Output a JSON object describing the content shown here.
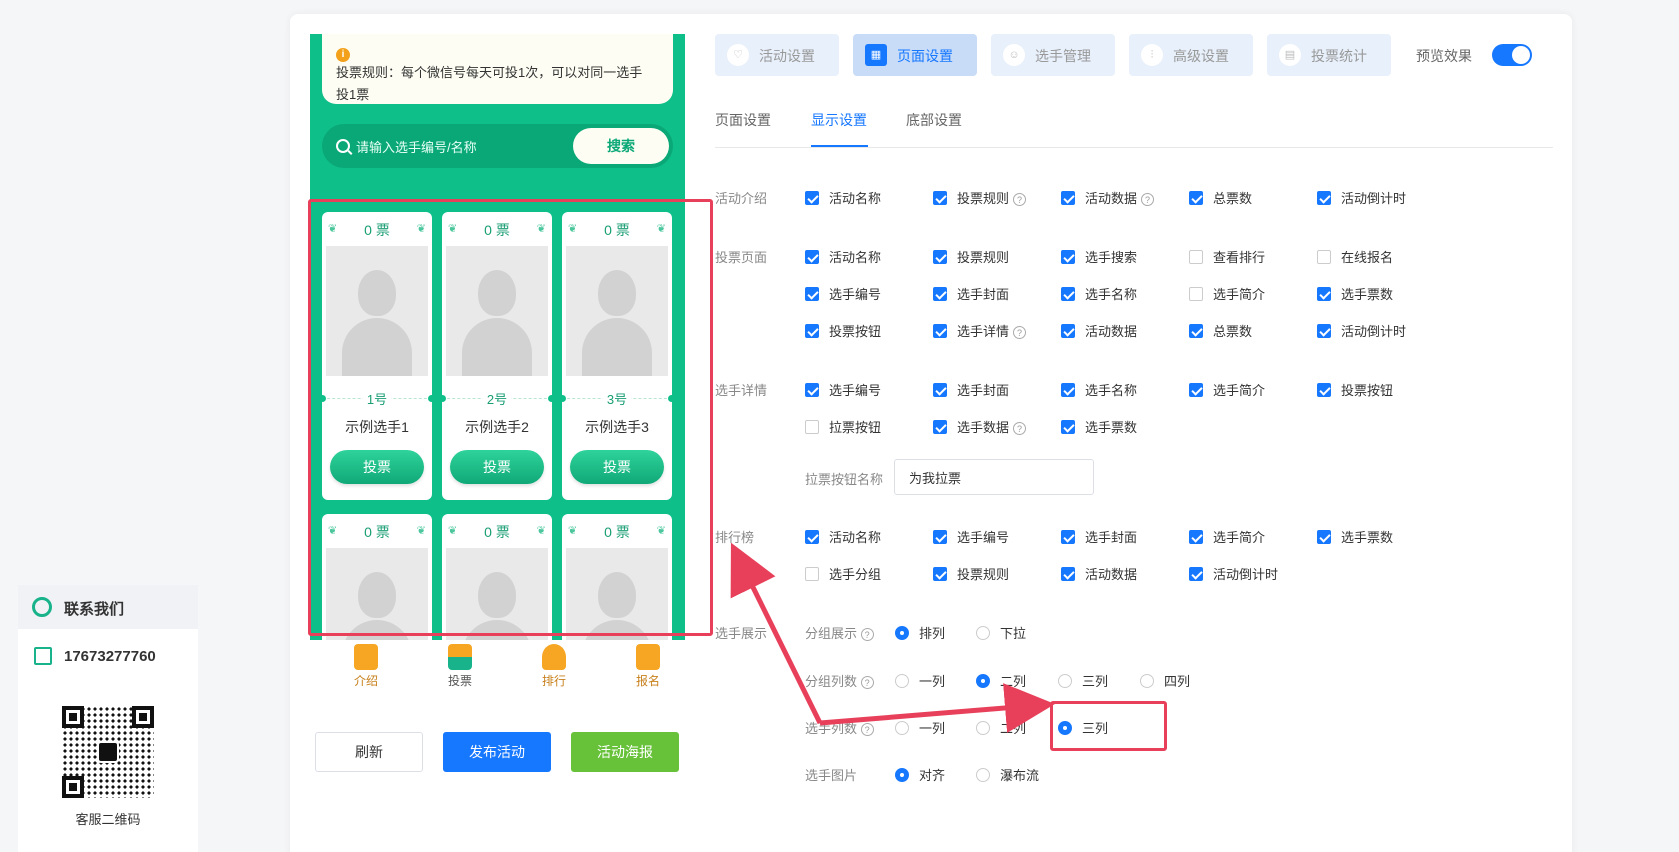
{
  "preview": {
    "rule_text": "投票规则：每个微信号每天可投1次，可以对同一选手投1票",
    "search_placeholder": "请输入选手编号/名称",
    "search_button": "搜索",
    "players": [
      {
        "votes": "0 票",
        "number": "1号",
        "name": "示例选手1",
        "vote_button": "投票"
      },
      {
        "votes": "0 票",
        "number": "2号",
        "name": "示例选手2",
        "vote_button": "投票"
      },
      {
        "votes": "0 票",
        "number": "3号",
        "name": "示例选手3",
        "vote_button": "投票"
      },
      {
        "votes": "0 票"
      },
      {
        "votes": "0 票"
      },
      {
        "votes": "0 票"
      }
    ],
    "nav": [
      {
        "label": "介绍",
        "icon": "document-icon"
      },
      {
        "label": "投票",
        "icon": "ballot-box-icon"
      },
      {
        "label": "排行",
        "icon": "trophy-icon"
      },
      {
        "label": "报名",
        "icon": "signup-icon"
      }
    ],
    "buttons": {
      "refresh": "刷新",
      "publish": "发布活动",
      "poster": "活动海报"
    }
  },
  "top_tabs": [
    {
      "label": "活动设置",
      "icon": "heart-icon"
    },
    {
      "label": "页面设置",
      "icon": "layout-icon",
      "active": true
    },
    {
      "label": "选手管理",
      "icon": "user-icon"
    },
    {
      "label": "高级设置",
      "icon": "sliders-icon"
    },
    {
      "label": "投票统计",
      "icon": "chart-icon"
    }
  ],
  "preview_toggle": {
    "label": "预览效果",
    "on": true
  },
  "sub_tabs": [
    {
      "label": "页面设置"
    },
    {
      "label": "显示设置",
      "active": true
    },
    {
      "label": "底部设置"
    }
  ],
  "sections": {
    "intro": {
      "label": "活动介绍",
      "items": [
        {
          "label": "活动名称",
          "checked": true
        },
        {
          "label": "投票规则",
          "checked": true,
          "help": "?"
        },
        {
          "label": "活动数据",
          "checked": true,
          "help": "?"
        },
        {
          "label": "总票数",
          "checked": true
        },
        {
          "label": "活动倒计时",
          "checked": true
        }
      ]
    },
    "vote_page": {
      "label": "投票页面",
      "items": [
        {
          "label": "活动名称",
          "checked": true
        },
        {
          "label": "投票规则",
          "checked": true
        },
        {
          "label": "选手搜索",
          "checked": true
        },
        {
          "label": "查看排行",
          "checked": false
        },
        {
          "label": "在线报名",
          "checked": false
        },
        {
          "label": "选手编号",
          "checked": true
        },
        {
          "label": "选手封面",
          "checked": true
        },
        {
          "label": "选手名称",
          "checked": true
        },
        {
          "label": "选手简介",
          "checked": false
        },
        {
          "label": "选手票数",
          "checked": true
        },
        {
          "label": "投票按钮",
          "checked": true
        },
        {
          "label": "选手详情",
          "checked": true,
          "help": "?"
        },
        {
          "label": "活动数据",
          "checked": true
        },
        {
          "label": "总票数",
          "checked": true
        },
        {
          "label": "活动倒计时",
          "checked": true
        }
      ]
    },
    "player_detail": {
      "label": "选手详情",
      "items": [
        {
          "label": "选手编号",
          "checked": true
        },
        {
          "label": "选手封面",
          "checked": true
        },
        {
          "label": "选手名称",
          "checked": true
        },
        {
          "label": "选手简介",
          "checked": true
        },
        {
          "label": "投票按钮",
          "checked": true
        },
        {
          "label": "拉票按钮",
          "checked": false
        },
        {
          "label": "选手数据",
          "checked": true,
          "help": "?"
        },
        {
          "label": "选手票数",
          "checked": true
        }
      ],
      "canvass_label": "拉票按钮名称",
      "canvass_value": "为我拉票"
    },
    "ranking": {
      "label": "排行榜",
      "items": [
        {
          "label": "活动名称",
          "checked": true
        },
        {
          "label": "选手编号",
          "checked": true
        },
        {
          "label": "选手封面",
          "checked": true
        },
        {
          "label": "选手简介",
          "checked": true
        },
        {
          "label": "选手票数",
          "checked": true
        },
        {
          "label": "选手分组",
          "checked": false
        },
        {
          "label": "投票规则",
          "checked": true
        },
        {
          "label": "活动数据",
          "checked": true
        },
        {
          "label": "活动倒计时",
          "checked": true
        }
      ]
    },
    "display": {
      "label": "选手展示",
      "group_display": {
        "label": "分组展示",
        "help": "?",
        "options": [
          "排列",
          "下拉"
        ],
        "selected": 0
      },
      "group_columns": {
        "label": "分组列数",
        "help": "?",
        "options": [
          "一列",
          "二列",
          "三列",
          "四列"
        ],
        "selected": 1
      },
      "player_columns": {
        "label": "选手列数",
        "help": "?",
        "options": [
          "一列",
          "二列",
          "三列"
        ],
        "selected": 2
      },
      "player_image": {
        "label": "选手图片",
        "options": [
          "对齐",
          "瀑布流"
        ],
        "selected": 0
      }
    }
  },
  "contact": {
    "title": "联系我们",
    "phone": "17673277760",
    "qr_caption": "客服二维码"
  },
  "colors": {
    "accent": "#1677ff",
    "green": "#0fbf8a",
    "highlight": "#e8405a"
  }
}
